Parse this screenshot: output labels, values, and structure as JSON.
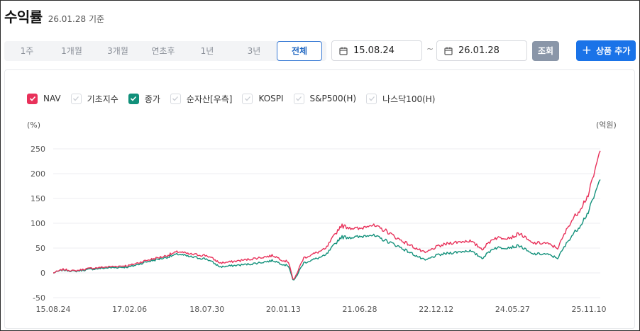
{
  "header": {
    "title": "수익률",
    "as_of": "26.01.28 기준"
  },
  "period_tabs": [
    {
      "label": "1주",
      "active": false
    },
    {
      "label": "1개월",
      "active": false
    },
    {
      "label": "3개월",
      "active": false
    },
    {
      "label": "연초후",
      "active": false
    },
    {
      "label": "1년",
      "active": false
    },
    {
      "label": "3년",
      "active": false
    },
    {
      "label": "전체",
      "active": true
    }
  ],
  "date_range": {
    "start": "15.08.24",
    "separator": "~",
    "end": "26.01.28"
  },
  "search_label": "조회",
  "add_label": "상품 추가",
  "legend": [
    {
      "label": "NAV",
      "checked": true,
      "color": "#e8315a"
    },
    {
      "label": "기초지수",
      "checked": false
    },
    {
      "label": "종가",
      "checked": true,
      "color": "#11907a"
    },
    {
      "label": "순자산[우측]",
      "checked": false
    },
    {
      "label": "KOSPI",
      "checked": false
    },
    {
      "label": "S&P500(H)",
      "checked": false
    },
    {
      "label": "나스닥100(H)",
      "checked": false
    }
  ],
  "chart_data": {
    "type": "line",
    "y_unit_left": "(%)",
    "y_unit_right": "(억원)",
    "ylim": [
      -50,
      250
    ],
    "yticks": [
      -50,
      0,
      50,
      100,
      150,
      200,
      250
    ],
    "xticks": [
      "15.08.24",
      "17.02.06",
      "18.07.30",
      "20.01.13",
      "21.06.28",
      "22.12.12",
      "24.05.27",
      "25.11.10"
    ],
    "grid": true,
    "series": [
      {
        "name": "NAV",
        "color": "#e8315a",
        "points": [
          [
            "15.08.24",
            0
          ],
          [
            "15.11.01",
            7
          ],
          [
            "16.01.20",
            4
          ],
          [
            "16.05.01",
            9
          ],
          [
            "16.09.01",
            12
          ],
          [
            "17.02.06",
            15
          ],
          [
            "17.06.01",
            25
          ],
          [
            "17.10.01",
            33
          ],
          [
            "18.01.15",
            43
          ],
          [
            "18.03.20",
            38
          ],
          [
            "18.07.30",
            35
          ],
          [
            "18.10.29",
            20
          ],
          [
            "19.01.07",
            22
          ],
          [
            "19.06.03",
            28
          ],
          [
            "19.11.04",
            35
          ],
          [
            "20.01.13",
            25
          ],
          [
            "20.02.20",
            22
          ],
          [
            "20.03.23",
            -17
          ],
          [
            "20.06.01",
            30
          ],
          [
            "20.11.02",
            48
          ],
          [
            "21.02.15",
            95
          ],
          [
            "21.06.28",
            88
          ],
          [
            "21.09.01",
            98
          ],
          [
            "21.12.27",
            85
          ],
          [
            "22.03.14",
            70
          ],
          [
            "22.06.20",
            55
          ],
          [
            "22.09.26",
            40
          ],
          [
            "22.12.12",
            52
          ],
          [
            "23.03.13",
            60
          ],
          [
            "23.07.31",
            65
          ],
          [
            "23.10.30",
            48
          ],
          [
            "24.01.15",
            70
          ],
          [
            "24.05.27",
            72
          ],
          [
            "24.07.15",
            80
          ],
          [
            "24.10.07",
            60
          ],
          [
            "25.01.13",
            60
          ],
          [
            "25.04.07",
            50
          ],
          [
            "25.06.30",
            100
          ],
          [
            "25.09.01",
            125
          ],
          [
            "25.11.10",
            160
          ],
          [
            "26.01.28",
            246
          ]
        ]
      },
      {
        "name": "종가",
        "color": "#11907a",
        "points": [
          [
            "15.08.24",
            0
          ],
          [
            "15.11.01",
            6
          ],
          [
            "16.01.20",
            3
          ],
          [
            "16.05.01",
            7
          ],
          [
            "16.09.01",
            10
          ],
          [
            "17.02.06",
            12
          ],
          [
            "17.06.01",
            22
          ],
          [
            "17.10.01",
            30
          ],
          [
            "18.01.15",
            38
          ],
          [
            "18.03.20",
            33
          ],
          [
            "18.07.30",
            28
          ],
          [
            "18.10.29",
            12
          ],
          [
            "19.01.07",
            14
          ],
          [
            "19.06.03",
            18
          ],
          [
            "19.11.04",
            25
          ],
          [
            "20.01.13",
            17
          ],
          [
            "20.02.20",
            14
          ],
          [
            "20.03.23",
            -18
          ],
          [
            "20.06.01",
            20
          ],
          [
            "20.11.02",
            35
          ],
          [
            "21.02.15",
            72
          ],
          [
            "21.06.28",
            72
          ],
          [
            "21.09.01",
            78
          ],
          [
            "21.12.27",
            65
          ],
          [
            "22.03.14",
            55
          ],
          [
            "22.06.20",
            40
          ],
          [
            "22.09.26",
            25
          ],
          [
            "22.12.12",
            35
          ],
          [
            "23.03.13",
            40
          ],
          [
            "23.07.31",
            45
          ],
          [
            "23.10.30",
            30
          ],
          [
            "24.01.15",
            50
          ],
          [
            "24.05.27",
            52
          ],
          [
            "24.07.15",
            55
          ],
          [
            "24.10.07",
            38
          ],
          [
            "25.01.13",
            38
          ],
          [
            "25.04.07",
            30
          ],
          [
            "25.06.30",
            70
          ],
          [
            "25.09.01",
            92
          ],
          [
            "25.11.10",
            125
          ],
          [
            "26.01.28",
            188
          ]
        ]
      }
    ]
  }
}
